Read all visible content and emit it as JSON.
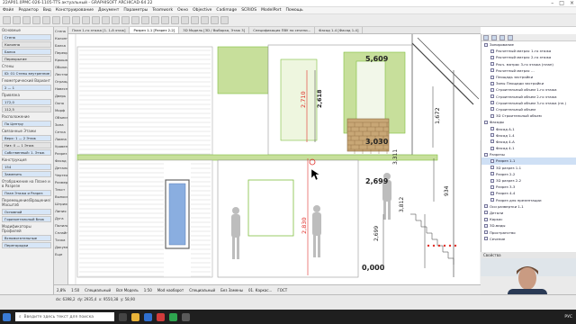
{
  "window": {
    "title": "22AP01.0PMC-026-1105-TTS актуальный - GRAPHISOFT ARCHICAD-64 22"
  },
  "menu": [
    "Файл",
    "Редактор",
    "Вид",
    "Конструирование",
    "Документ",
    "Параметры",
    "Teamwork",
    "Окно",
    "Objective",
    "Cadimage",
    "SCRIOS",
    "ModelPort",
    "Помощь"
  ],
  "toolbox": {
    "sections": [
      {
        "title": "Основные",
        "rows": [
          "Стена",
          "Колонна",
          "Балка",
          "Перекрытие"
        ]
      },
      {
        "title": "Стены",
        "rows": [
          "ID: 01 Стены внутренние"
        ]
      },
      {
        "title": "Геометрический Вариант",
        "rows": [
          "2 — 1"
        ]
      },
      {
        "title": "Привязка",
        "rows": [
          "172,0",
          "112,5"
        ]
      },
      {
        "title": "Расположение",
        "rows": [
          "По Центру"
        ]
      },
      {
        "title": "Связанные Этажи",
        "rows": [
          "Верх: 1 — 2 Этаж",
          "Низ: 0 — 1 Этаж",
          "Собственный: 1. Этаж"
        ]
      },
      {
        "title": "Конструкция",
        "rows": [
          "154"
        ]
      },
      {
        "title": "",
        "rows": [
          "Заменить"
        ]
      },
      {
        "title": "Отображение на Плане и в Разрезе",
        "rows": [
          "План Этажа и Разрез"
        ]
      },
      {
        "title": "Перемещение/Вращение/Масштаб",
        "rows": [
          "Основной"
        ]
      },
      {
        "title": "",
        "rows": [
          "Горизонтальный блок"
        ]
      },
      {
        "title": "Модификаторы Профилей",
        "rows": [
          "Вспомогательные"
        ]
      },
      {
        "title": "",
        "rows": [
          "Перегородки"
        ]
      }
    ]
  },
  "infobox": [
    "Стена",
    "Колонна",
    "Балка",
    "Перекрытие",
    "Крыша",
    "Оболочка",
    "Лестница",
    "Ограждение",
    "Навесная",
    "Дверь",
    "Окно",
    "Морф",
    "Объект",
    "Зона",
    "Сетка",
    "Лампа",
    "Уровень",
    "Разрез",
    "Фасад",
    "Деталь",
    "Чертеж",
    "Размер",
    "Текст",
    "Выноска",
    "Штриховка",
    "Линия",
    "Дуга",
    "Полилиния",
    "Сплайн",
    "Точка",
    "Документ",
    "Еще"
  ],
  "tabs": [
    "План 1-го этажа [1. 1-й этаж]",
    "Разрез 1-1 [Разрез 2-2]",
    "3D Модель [3D / Выборка, Этаж 3]",
    "Спецификация ПВУ по сечени...",
    "Фасад 1-4 [Фасад 1-4]"
  ],
  "active_tab": 1,
  "drawing": {
    "dims": [
      "5,609",
      "2,710",
      "2,618",
      "1,672",
      "3,030",
      "2,699",
      "3,812",
      "3,311",
      "934",
      "2,830",
      "2,699",
      "0,000"
    ]
  },
  "statusbar": [
    "2,8%",
    "1:50",
    "Специальный",
    "Вся Модель",
    "1:50",
    "Mod наоборот",
    "Специальный",
    "Без Замены",
    "01. Каркас...",
    "ГОСТ"
  ],
  "coords": [
    "dx: 6398,2",
    "dy: 2935,4",
    "x: 9550,38",
    "y: 58,90"
  ],
  "navigator": {
    "items": [
      {
        "label": "Зонирование",
        "level": 0
      },
      {
        "label": "Расчетный матрас 1-го этажа",
        "level": 1
      },
      {
        "label": "Расчетный матрас 2-го этажа",
        "level": 1
      },
      {
        "label": "Расч. матрас 3-го этажа (план)",
        "level": 1
      },
      {
        "label": "Расчетный матрас ...",
        "level": 1
      },
      {
        "label": "Площадь застройки",
        "level": 1
      },
      {
        "label": "Зоны Площади застройки",
        "level": 1
      },
      {
        "label": "Строительный объем 1-го этажа",
        "level": 1
      },
      {
        "label": "Строительный объем 2-го этажа",
        "level": 1
      },
      {
        "label": "Строительный объем 3-го этажа (пл.)",
        "level": 1
      },
      {
        "label": "Строительный объем",
        "level": 1
      },
      {
        "label": "3D Строительный объем",
        "level": 1
      },
      {
        "label": "Фасады",
        "level": 0
      },
      {
        "label": "Фасад А-1",
        "level": 1
      },
      {
        "label": "Фасад 1-4",
        "level": 1
      },
      {
        "label": "Фасад 4-А",
        "level": 1
      },
      {
        "label": "Фасад 4-1",
        "level": 1
      },
      {
        "label": "Разрезы",
        "level": 0
      },
      {
        "label": "Разрез 1-1",
        "level": 1,
        "selected": true
      },
      {
        "label": "3D разрез 1-1",
        "level": 1
      },
      {
        "label": "Разрез 2-2",
        "level": 1
      },
      {
        "label": "3D разрез 2-2",
        "level": 1
      },
      {
        "label": "Разрез 3-3",
        "level": 1
      },
      {
        "label": "Разрез 4-4",
        "level": 1
      },
      {
        "label": "Разрез для презентации",
        "level": 1
      },
      {
        "label": "Оси развертки 1-1",
        "level": 0
      },
      {
        "label": "Детали",
        "level": 0
      },
      {
        "label": "Каркас",
        "level": 0
      },
      {
        "label": "3D-виды",
        "level": 0
      },
      {
        "label": "Пространство",
        "level": 0
      },
      {
        "label": "Сечение",
        "level": 0
      }
    ],
    "props_label": "Свойства"
  },
  "taskbar": {
    "search": "Введите здесь текст для поиска",
    "time": "",
    "lang": "РУС"
  },
  "colors": {
    "wall_green": "#c7df9b",
    "green_line": "#7fbf3f",
    "red_dim": "#e0302a",
    "brick": "#c8a776",
    "glass": "#8aaee0"
  }
}
